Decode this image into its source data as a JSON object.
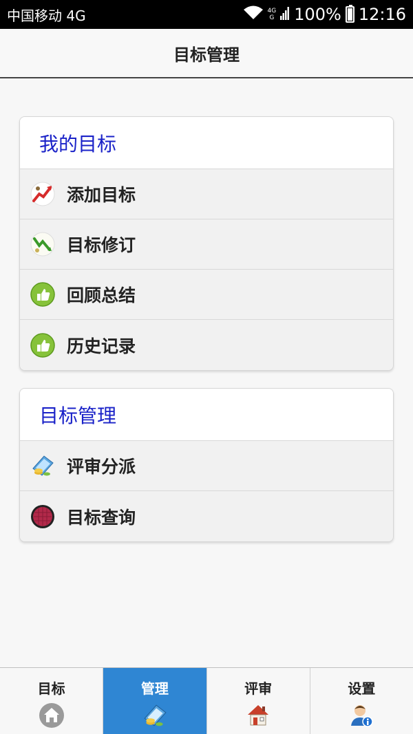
{
  "status_bar": {
    "carrier": "中国移动 4G",
    "network_top": "4G",
    "network_bottom": "G",
    "battery": "100%",
    "time": "12:16"
  },
  "header": {
    "title": "目标管理"
  },
  "sections": [
    {
      "title": "我的目标",
      "items": [
        {
          "label": "添加目标",
          "icon": "chart-up-icon"
        },
        {
          "label": "目标修订",
          "icon": "chart-down-icon"
        },
        {
          "label": "回顾总结",
          "icon": "thumbs-up-icon"
        },
        {
          "label": "历史记录",
          "icon": "thumbs-up-icon"
        }
      ]
    },
    {
      "title": "目标管理",
      "items": [
        {
          "label": "评审分派",
          "icon": "laptop-coins-icon"
        },
        {
          "label": "目标查询",
          "icon": "red-circle-icon"
        }
      ]
    }
  ],
  "tabs": [
    {
      "label": "目标",
      "icon": "home-gray-icon",
      "active": false
    },
    {
      "label": "管理",
      "icon": "laptop-coins-icon",
      "active": true
    },
    {
      "label": "评审",
      "icon": "house-icon",
      "active": false
    },
    {
      "label": "设置",
      "icon": "user-info-icon",
      "active": false
    }
  ],
  "colors": {
    "section_title": "#1a22c8",
    "active_tab": "#2f86d3"
  }
}
